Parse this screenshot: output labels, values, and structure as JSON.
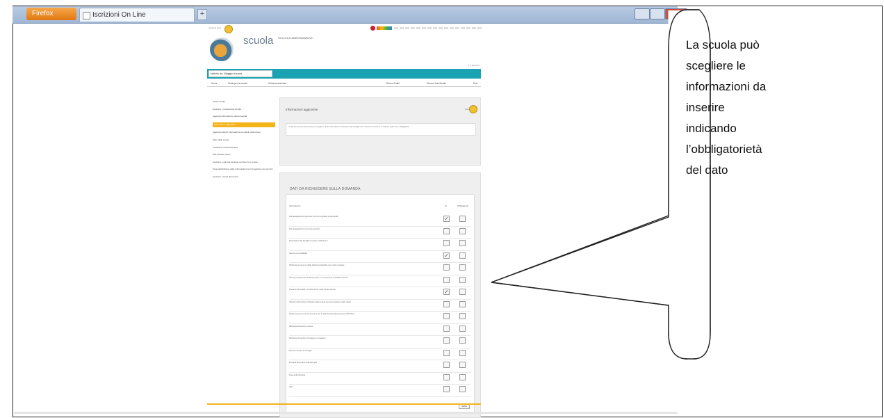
{
  "browser": {
    "app_button": "Firefox",
    "tab_title": "Iscrizioni On Line",
    "new_tab": "+"
  },
  "site": {
    "beta_label": "versione beta",
    "logo_text": "scuola",
    "header_link": "SCUOLA  ABBONAMENTI",
    "school_name": "Istituto Ist. Maggio scuola",
    "top_right_note": "a.s. 2013-14",
    "menu": [
      "Home",
      "Guide per la scuola",
      "Chiusura iscrizioni",
      "Elenco Profili",
      "Elenco Liste Scuole",
      "Esci"
    ],
    "sidenav": [
      "Scelta scuola",
      "Gestione / modifica dati scuola",
      "Aggiungi informazioni sulla domanda",
      "Informazioni aggiuntive",
      "Aggiungi ulteriori informazioni al modulo d'iscrizione",
      "Stato delle scuole",
      "Visualizza moduli iscrizione",
      "Dati accesso utenti",
      "Gestione e stampa riepilogo iscrizioni per scuola",
      "Personalizzazione delle informazioni per l'erogazione del servizio",
      "Gestione e firma documenti"
    ],
    "main_title": "Informazioni aggiuntive",
    "help_label": "Guida",
    "main_note": "In questa sezione la scuola può scegliere quali informazioni richiedere alle famiglie nel modulo di iscrizione e indicare quali sono obbligatorie.",
    "panel_title": "DATI DA RICHIEDERE SULLA DOMANDA",
    "col_info": "Informazioni",
    "col_si": "Sì",
    "col_obbl": "Obbligatorio",
    "rows": [
      {
        "label": "Dati anagrafici del genitore che ha compilato la domanda",
        "si": true
      },
      {
        "label": "Dati anagrafici del secondo genitore",
        "si": false
      },
      {
        "label": "Dati relativi alla famiglia di origine dell'alunno",
        "si": false
      },
      {
        "label": "Alunno con disabilità",
        "si": true
      },
      {
        "label": "Richiesta di esonero dalle attività scolastiche per motivi di salute",
        "si": false
      },
      {
        "label": "Alunno proveniente da altra scuola o con percorso scolastico diverso",
        "si": false
      },
      {
        "label": "Presenza di fratelli o sorelle iscritti nella stessa scuola",
        "si": true
      },
      {
        "label": "Ulteriori informazioni richieste dalla scuola per la formazione delle classi",
        "si": false
      },
      {
        "label": "Preferenza per il tempo scuola e per le attività opzionali proposte dall'istituto",
        "si": false
      },
      {
        "label": "Richiesta di servizio mensa",
        "si": false
      },
      {
        "label": "Richiesta di servizio di trasporto scolastico",
        "si": false
      },
      {
        "label": "Dati del medico di famiglia",
        "si": false
      },
      {
        "label": "Recapiti alternativi della famiglia",
        "si": false
      },
      {
        "label": "Note della famiglia",
        "si": false
      },
      {
        "label": "Altro",
        "si": false
      }
    ],
    "save_label": "Salva"
  },
  "callout": {
    "lines": [
      "La scuola può",
      "scegliere le",
      "informazioni da",
      "inserire",
      "indicando",
      "l’obbligatorietà",
      "del dato"
    ]
  },
  "colors": {
    "teal": "#1aa3b3",
    "accent": "#f2b31b",
    "firefox": "#e07812"
  }
}
